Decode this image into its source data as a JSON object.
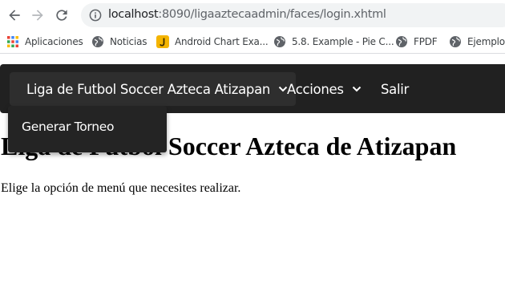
{
  "browser": {
    "url_host": "localhost",
    "url_rest": ":8090/ligaaztecaadmin/faces/login.xhtml",
    "bookmarks": [
      {
        "label": "Aplicaciones",
        "icon": "apps-grid-icon"
      },
      {
        "label": "Noticias",
        "icon": "globe-icon"
      },
      {
        "label": "Android Chart Exa...",
        "icon": "j-logo-icon"
      },
      {
        "label": "5.8. Example - Pie C...",
        "icon": "globe-icon"
      },
      {
        "label": "FPDF",
        "icon": "globe-icon"
      },
      {
        "label": "Ejemplo",
        "icon": "globe-icon"
      }
    ]
  },
  "navbar": {
    "brand_menu": "Liga de Futbol Soccer Azteca Atizapan",
    "actions_menu": "Acciones",
    "logout": "Salir",
    "dropdown_items": [
      "Generar Torneo"
    ]
  },
  "page": {
    "heading": "Liga de Futbol Soccer Azteca de Atizapan",
    "body_text": "Elige la opción de menú que necesites realizar."
  },
  "colors": {
    "navbar_bg": "#212121",
    "dropdown_bg": "#242424",
    "omnibox_bg": "#f1f3f4",
    "j_logo": "#f4b400"
  }
}
